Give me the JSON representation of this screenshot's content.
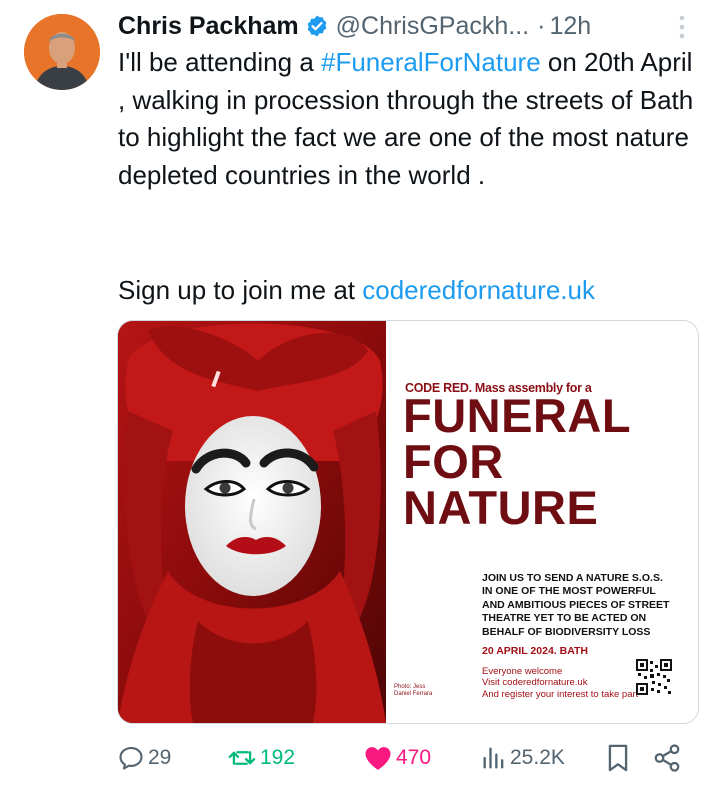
{
  "author": {
    "name": "Chris Packham",
    "handle": "@ChrisGPackh...",
    "separator": "·",
    "time": "12h"
  },
  "tweet": {
    "line_pre": "I'll be attending a ",
    "hashtag": "#FuneralForNature",
    "line_post": " on 20th April , walking in procession through the streets of Bath to highlight the fact we are one of the most nature depleted countries in the world .",
    "signup_pre": "Sign up to join me at ",
    "signup_link": "coderedfornature.uk"
  },
  "poster": {
    "kicker": "CODE RED. Mass assembly for a",
    "title_lines": [
      "FUNERAL",
      "FOR",
      "NATURE"
    ],
    "body_lines": [
      "JOIN US TO SEND A NATURE S.O.S.",
      "IN ONE OF THE MOST POWERFUL",
      "AND AMBITIOUS PIECES OF STREET",
      "THEATRE YET TO BE ACTED ON",
      "BEHALF OF BIODIVERSITY LOSS"
    ],
    "date": "20 APRIL 2024. BATH",
    "footer_lines": [
      "Everyone welcome",
      "Visit coderedfornature.uk",
      "And register your interest to take part"
    ],
    "credit_lines": [
      "Photo: Jess",
      "Daniel Ferrara"
    ]
  },
  "actions": {
    "replies": "29",
    "reposts": "192",
    "likes": "470",
    "views": "25.2K"
  },
  "colors": {
    "link": "#1d9bf0",
    "repost": "#00ba7c",
    "like": "#f91880",
    "muted": "#536471",
    "poster_red": "#6e0e13"
  },
  "icons": [
    "verified-badge-icon",
    "more-icon",
    "reply-icon",
    "repost-icon",
    "heart-icon",
    "views-icon",
    "bookmark-icon",
    "share-icon"
  ]
}
